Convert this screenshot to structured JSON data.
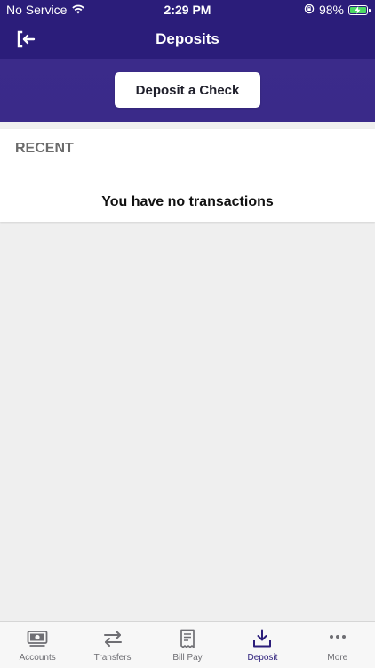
{
  "status_bar": {
    "carrier": "No Service",
    "time": "2:29 PM",
    "battery": "98%",
    "battery_level": 0.98
  },
  "header": {
    "title": "Deposits"
  },
  "deposit": {
    "button_label": "Deposit a Check"
  },
  "recent": {
    "label": "RECENT",
    "empty_message": "You have no transactions"
  },
  "tabs": [
    {
      "label": "Accounts",
      "icon": "accounts-icon",
      "active": false
    },
    {
      "label": "Transfers",
      "icon": "transfers-icon",
      "active": false
    },
    {
      "label": "Bill Pay",
      "icon": "bill-pay-icon",
      "active": false
    },
    {
      "label": "Deposit",
      "icon": "deposit-icon",
      "active": true
    },
    {
      "label": "More",
      "icon": "more-icon",
      "active": false
    }
  ],
  "colors": {
    "brand": "#2b1d7a",
    "band": "#3b2b8a",
    "inactive_tab": "#6e6e73",
    "battery_fill": "#4cd964"
  }
}
